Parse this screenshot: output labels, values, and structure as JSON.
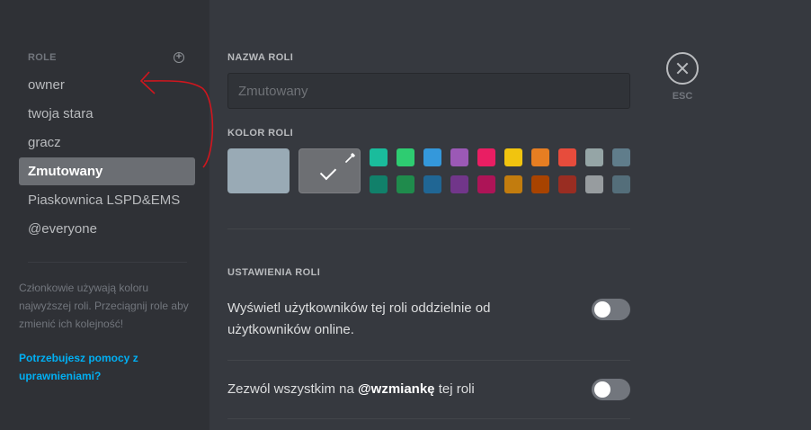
{
  "sidebar": {
    "header": "ROLE",
    "roles": [
      {
        "label": "owner"
      },
      {
        "label": "twoja stara"
      },
      {
        "label": "gracz"
      },
      {
        "label": "Zmutowany"
      },
      {
        "label": "Piaskownica LSPD&EMS"
      },
      {
        "label": "@everyone"
      }
    ],
    "hint": "Członkowie używają koloru najwyższej roli. Przeciągnij role aby zmienić ich kolejność!",
    "help_link": "Potrzebujesz pomocy z uprawnieniami?"
  },
  "main": {
    "name_section": "NAZWA ROLI",
    "name_value": "",
    "name_placeholder": "Zmutowany",
    "color_section": "KOLOR ROLI",
    "default_color": "#99aab5",
    "swatches_row1": [
      "#1abc9c",
      "#2ecc71",
      "#3498db",
      "#9b59b6",
      "#e91e63",
      "#f1c40f",
      "#e67e22",
      "#e74c3c",
      "#95a5a6",
      "#607d8b"
    ],
    "swatches_row2": [
      "#11806a",
      "#1f8b4c",
      "#206694",
      "#71368a",
      "#ad1457",
      "#c27c0e",
      "#a84300",
      "#992d22",
      "#979c9f",
      "#546e7a"
    ],
    "settings_section": "USTAWIENIA ROLI",
    "settings": [
      {
        "pre": "Wyświetl użytkowników tej roli oddzielnie od użytkowników online.",
        "bold": "",
        "post": "",
        "on": false
      },
      {
        "pre": "Zezwól wszystkim na ",
        "bold": "@wzmiankę",
        "post": " tej roli",
        "on": false
      }
    ]
  },
  "esc": {
    "label": "ESC"
  }
}
